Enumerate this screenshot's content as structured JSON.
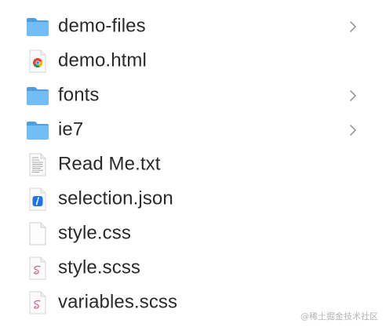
{
  "items": [
    {
      "name": "demo-files",
      "kind": "folder",
      "has_children": true
    },
    {
      "name": "demo.html",
      "kind": "chrome-html",
      "has_children": false
    },
    {
      "name": "fonts",
      "kind": "folder",
      "has_children": true
    },
    {
      "name": "ie7",
      "kind": "folder",
      "has_children": true
    },
    {
      "name": "Read Me.txt",
      "kind": "text-document",
      "has_children": false
    },
    {
      "name": "selection.json",
      "kind": "json-document",
      "has_children": false
    },
    {
      "name": "style.css",
      "kind": "blank-document",
      "has_children": false
    },
    {
      "name": "style.scss",
      "kind": "sass-document",
      "has_children": false
    },
    {
      "name": "variables.scss",
      "kind": "sass-document",
      "has_children": false
    }
  ],
  "icons": {
    "folder": "folder-icon",
    "chrome-html": "chrome-document-icon",
    "text-document": "text-document-icon",
    "json-document": "json-document-icon",
    "blank-document": "blank-document-icon",
    "sass-document": "sass-document-icon",
    "chevron": "chevron-right-icon"
  },
  "colors": {
    "folder": "#5aacea",
    "text": "#2a2a2a",
    "chevron": "#9a9a9a"
  },
  "watermark": "@稀土掘金技术社区"
}
